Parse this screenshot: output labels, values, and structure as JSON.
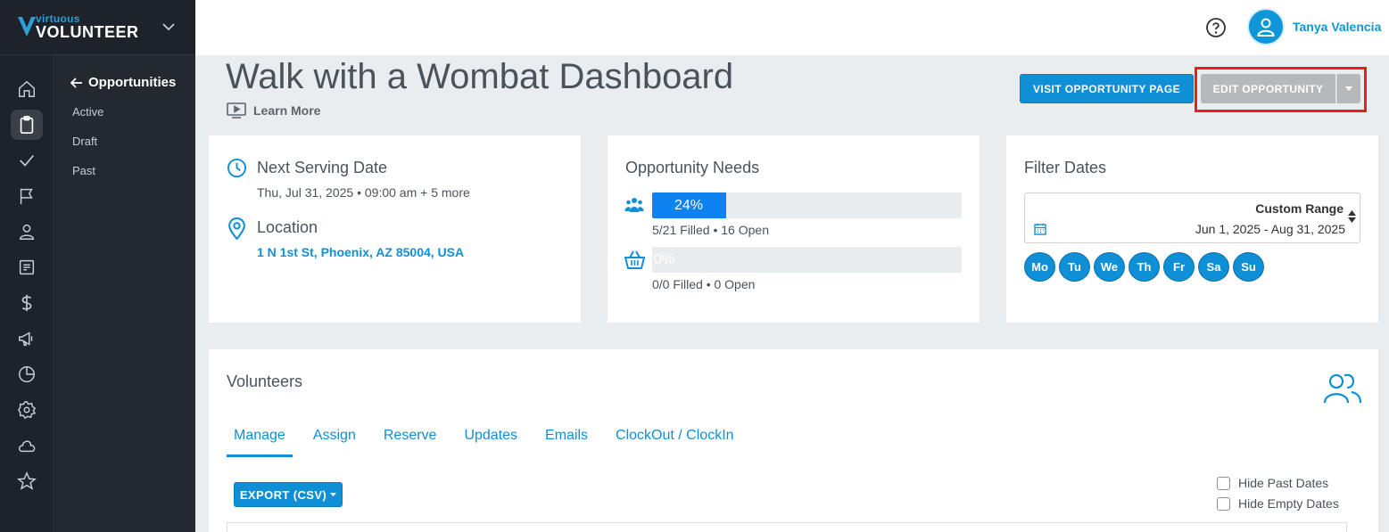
{
  "brand": {
    "top": "virtuous",
    "main": "VOLUNTEER"
  },
  "rail": {
    "icons": [
      "home-icon",
      "clipboard-icon",
      "check-icon",
      "flag-icon",
      "person-icon",
      "document-icon",
      "dollar-icon",
      "megaphone-icon",
      "pie-chart-icon",
      "gear-icon",
      "cloud-icon",
      "star-icon"
    ],
    "active": "clipboard-icon"
  },
  "subnav": {
    "back_label": "Opportunities",
    "items": [
      "Active",
      "Draft",
      "Past"
    ]
  },
  "header": {
    "user_name": "Tanya Valencia"
  },
  "page": {
    "title": "Walk with a Wombat Dashboard",
    "learn_more": "Learn More",
    "visit_button": "VISIT OPPORTUNITY PAGE",
    "edit_button": "EDIT OPPORTUNITY"
  },
  "serving": {
    "title": "Next Serving Date",
    "date": "Thu, Jul 31, 2025 • 09:00 am + 5 more",
    "location_title": "Location",
    "location": "1 N 1st St, Phoenix, AZ 85004, USA"
  },
  "needs": {
    "title": "Opportunity Needs",
    "rows": [
      {
        "icon": "people-icon",
        "percent_label": "24%",
        "fill_fraction": 0.24,
        "caption": "5/21 Filled • 16 Open"
      },
      {
        "icon": "basket-icon",
        "percent_label": "0%",
        "fill_fraction": 0,
        "caption": "0/0 Filled • 0 Open"
      }
    ]
  },
  "filter": {
    "title": "Filter Dates",
    "range_label": "Custom Range",
    "range_dates": "Jun 1, 2025 - Aug 31, 2025",
    "days": [
      "Mo",
      "Tu",
      "We",
      "Th",
      "Fr",
      "Sa",
      "Su"
    ]
  },
  "volunteers": {
    "title": "Volunteers",
    "tabs": [
      "Manage",
      "Assign",
      "Reserve",
      "Updates",
      "Emails",
      "ClockOut / ClockIn"
    ],
    "active_tab": "Manage",
    "export_label": "EXPORT (CSV)",
    "checkboxes": [
      "Hide Past Dates",
      "Hide Empty Dates"
    ]
  },
  "colors": {
    "accent": "#0f8fd5",
    "sidebar": "#1e2329",
    "highlight": "#e2231a"
  }
}
